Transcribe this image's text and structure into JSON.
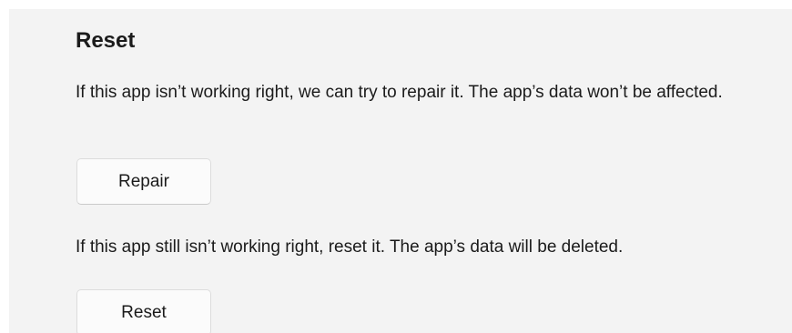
{
  "section": {
    "title": "Reset",
    "repair_description": "If this app isn’t working right, we can try to repair it. The app’s data won’t be affected.",
    "repair_button_label": "Repair",
    "reset_description": "If this app still isn’t working right, reset it. The app’s data will be deleted.",
    "reset_button_label": "Reset"
  }
}
